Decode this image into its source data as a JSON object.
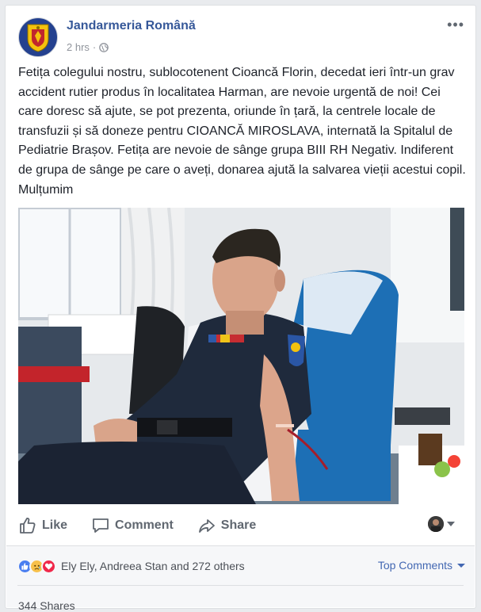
{
  "post": {
    "page_name": "Jandarmeria Română",
    "time": "2 hrs",
    "separator": "·",
    "privacy_icon": "globe-icon",
    "options_label": "•••",
    "text": "Fetița colegului nostru, sublocotenent Cioancă Florin, decedat ieri într-un grav accident rutier produs în localitatea Harman, are nevoie urgentă de noi! Cei care doresc să ajute, se pot prezenta, oriunde în țară, la centrele locale de transfuzii și să doneze pentru CIOANCĂ MIROSLAVA, internată la Spitalul de Pediatrie Brașov. Fetița are nevoie de sânge grupa BIII RH Negativ. Indiferent de grupa de sânge pe care o aveți, donarea ajută la salvarea vieții acestui copil. Mulțumim"
  },
  "actions": {
    "like": "Like",
    "comment": "Comment",
    "share": "Share"
  },
  "reactions": {
    "icons": [
      "like-reaction-icon",
      "sad-reaction-icon",
      "love-reaction-icon"
    ],
    "summary": "Ely Ely, Andreea Stan and 272 others",
    "top_comments": "Top Comments"
  },
  "shares": "344 Shares",
  "colors": {
    "link_blue": "#365899",
    "accent_blue": "#4267b2",
    "gray_text": "#606770",
    "like_blue": "#4a7ef0",
    "love_red": "#f0284a",
    "sad_yellow": "#f7c04a"
  }
}
